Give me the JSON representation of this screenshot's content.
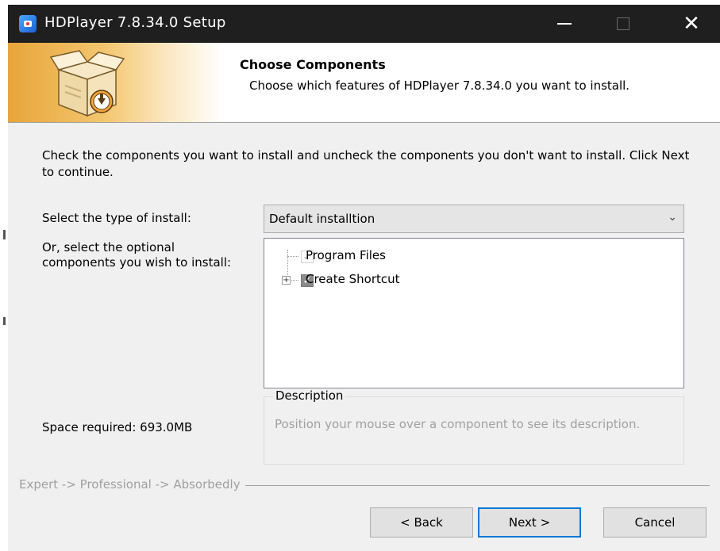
{
  "window": {
    "title": "HDPlayer 7.8.34.0 Setup",
    "minimize_label": "—",
    "close_label": "✕"
  },
  "header": {
    "title": "Choose Components",
    "subtitle": "Choose which features of HDPlayer 7.8.34.0 you want to install."
  },
  "body": {
    "intro": "Check the components you want to install and uncheck the components you don't want to install. Click Next to continue.",
    "install_type_label": "Select the type of install:",
    "install_type_value": "Default installtion",
    "optional_label": "Or, select the optional components you wish to install:",
    "components": [
      {
        "label": "Program Files",
        "checked": true,
        "disabled": true
      },
      {
        "label": "Create Shortcut",
        "checked": true,
        "disabled": false
      }
    ],
    "space_required": "Space required: 693.0MB",
    "description_title": "Description",
    "description_text": "Position your mouse over a component to see its description."
  },
  "branding": "Expert -> Professional -> Absorbedly",
  "buttons": {
    "back": "< Back",
    "next": "Next >",
    "cancel": "Cancel"
  },
  "colors": {
    "titlebar": "#1f1f1f",
    "accent": "#0078d7",
    "header_gradient": "#e8a53b"
  }
}
